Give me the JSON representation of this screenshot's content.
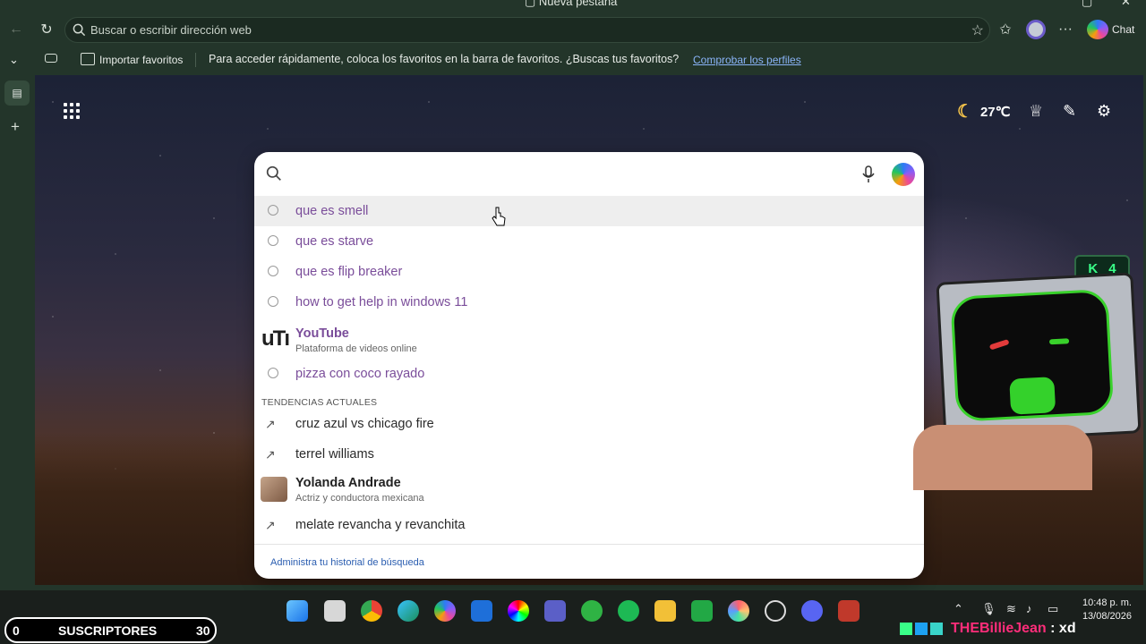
{
  "window": {
    "tab_title": "Nueva pestaña"
  },
  "address_bar": {
    "placeholder": "Buscar o escribir dirección web"
  },
  "toolbar": {
    "chat_label": "Chat"
  },
  "favorites_bar": {
    "import_label": "Importar favoritos",
    "message": "Para acceder rápidamente, coloca los favoritos en la barra de favoritos. ¿Buscas tus favoritos?",
    "link": "Comprobar los perfiles"
  },
  "weather": {
    "temperature": "27℃"
  },
  "search": {
    "history": [
      {
        "text": "que es smell"
      },
      {
        "text": "que es starve"
      },
      {
        "text": "que es flip breaker"
      },
      {
        "text": "how to get help in windows 11"
      }
    ],
    "youtube": {
      "logo": "uTı",
      "title": "YouTube",
      "subtitle": "Plataforma de videos online"
    },
    "history_more": {
      "text": "pizza con coco rayado"
    },
    "trending_header": "TENDENCIAS ACTUALES",
    "trending": [
      {
        "text": "cruz azul vs chicago fire"
      },
      {
        "text": "terrel williams"
      }
    ],
    "person": {
      "title": "Yolanda Andrade",
      "subtitle": "Actriz y conductora mexicana"
    },
    "trending_more": {
      "text": "melate revancha y revanchita"
    },
    "manage_link": "Administra tu historial de búsqueda"
  },
  "stream_overlay": {
    "counter_left": "0",
    "counter_label": "SUSCRIPTORES",
    "counter_right": "30",
    "badge": "4",
    "channel_name": "THEBillieJean",
    "channel_suffix": " : xd"
  },
  "taskbar": {
    "time": "10:48 p. m.",
    "date": "13/08/2026"
  }
}
